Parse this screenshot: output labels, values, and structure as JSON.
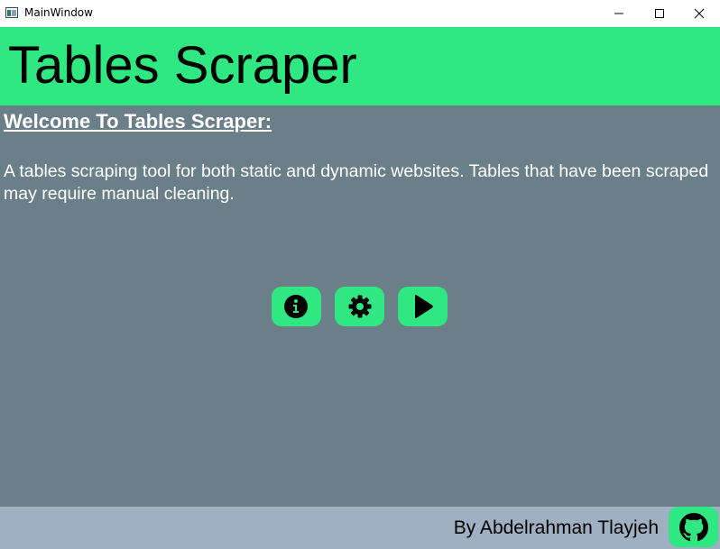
{
  "window": {
    "title": "MainWindow",
    "icon": "app-window-icon",
    "controls": [
      "minimize-icon",
      "maximize-icon",
      "close-icon"
    ]
  },
  "header": {
    "title": "Tables Scraper",
    "background": "#2fe882"
  },
  "main": {
    "welcome": "Welcome To Tables Scraper:",
    "description": "A tables scraping tool for both static and dynamic websites. Tables that have been scraped may require manual cleaning.",
    "background": "#6b7f89",
    "buttons": [
      {
        "name": "info",
        "icon": "info-icon"
      },
      {
        "name": "settings",
        "icon": "gear-icon"
      },
      {
        "name": "start",
        "icon": "play-icon"
      }
    ]
  },
  "footer": {
    "author": "By Abdelrahman Tlayjeh",
    "link_icon": "github-icon",
    "background": "#9fb0c2"
  }
}
